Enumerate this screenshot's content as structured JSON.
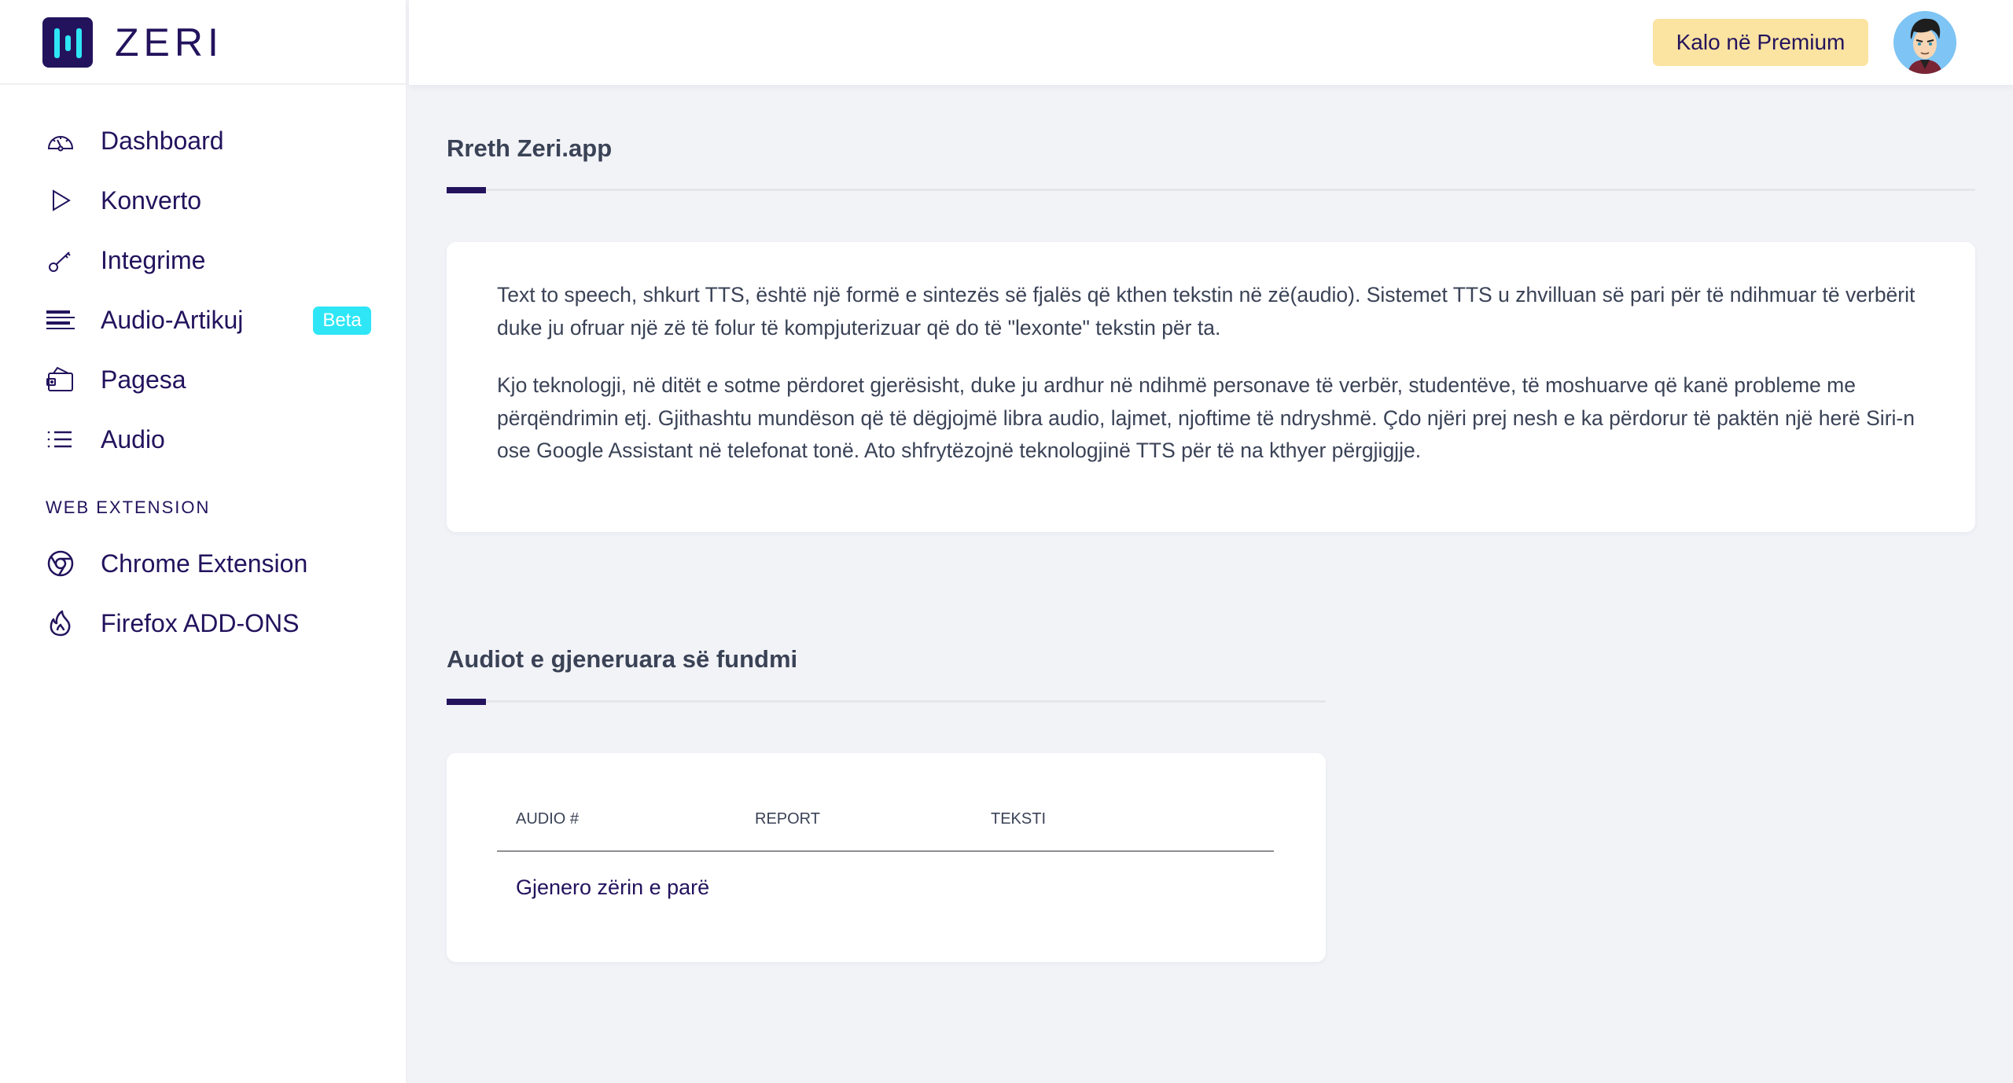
{
  "brand": {
    "name": "ZERI",
    "logo_icon": "equalizer-bars-logo"
  },
  "header": {
    "premium_button": "Kalo në Premium",
    "avatar_icon": "user-avatar-cartoon"
  },
  "sidebar": {
    "items": [
      {
        "label": "Dashboard",
        "icon": "speedometer-icon"
      },
      {
        "label": "Konverto",
        "icon": "play-icon"
      },
      {
        "label": "Integrime",
        "icon": "key-icon"
      },
      {
        "label": "Audio-Artikuj",
        "icon": "align-left-icon",
        "badge": "Beta"
      },
      {
        "label": "Pagesa",
        "icon": "wallet-icon"
      },
      {
        "label": "Audio",
        "icon": "list-icon"
      }
    ],
    "section_label": "WEB EXTENSION",
    "extension_items": [
      {
        "label": "Chrome Extension",
        "icon": "chrome-icon"
      },
      {
        "label": "Firefox ADD-ONS",
        "icon": "fire-icon"
      }
    ]
  },
  "about": {
    "title": "Rreth Zeri.app",
    "paragraphs": [
      "Text to speech, shkurt TTS, është një formë e sintezës së fjalës që kthen tekstin në zë(audio). Sistemet TTS u zhvilluan së pari për të ndihmuar të verbërit duke ju ofruar një zë të folur të kompjuterizuar që do të \"lexonte\" tekstin për ta.",
      "Kjo teknologji, në ditët e sotme përdoret gjerësisht, duke ju ardhur në ndihmë personave të verbër, studentëve, të moshuarve që kanë probleme me përqëndrimin etj. Gjithashtu mundëson që të dëgjojmë libra audio, lajmet, njoftime të ndryshmë. Çdo njëri prej nesh e ka përdorur të paktën një herë Siri-n ose Google Assistant në telefonat tonë. Ato shfrytëzojnë teknologjinë TTS për të na kthyer përgjigjje."
    ]
  },
  "recent": {
    "title": "Audiot e gjeneruara së fundmi",
    "columns": [
      "AUDIO #",
      "REPORT",
      "TEKSTI"
    ],
    "rows": [],
    "empty_message": "Gjenero zërin e parë"
  },
  "colors": {
    "primary": "#23135d",
    "accent_cyan": "#2ee6f5",
    "premium_bg": "#fbe3a1",
    "page_bg": "#f2f3f7"
  }
}
